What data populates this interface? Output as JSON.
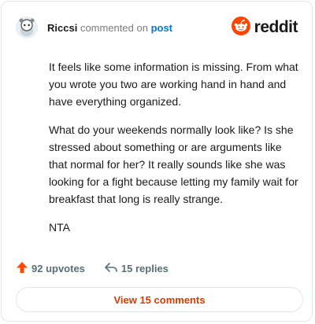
{
  "header": {
    "username": "Riccsi",
    "action_text": "commented on",
    "link_text": "post",
    "brand": "reddit",
    "avatar_icon": "snoo-avatar-icon",
    "brand_icon": "reddit-logo-icon",
    "brand_color": "#ff4500"
  },
  "comment": {
    "paragraphs": [
      "It feels like some information is missing. From what you wrote you two are working hand in hand and have everything organized.",
      "What do your weekends normally look like? Is she stressed about something or are arguments like that normal for her? It really sounds like she was looking for a fight because letting my family wait for breakfast that long is really strange.",
      "NTA"
    ]
  },
  "actions": {
    "upvotes": "92 upvotes",
    "replies": "15 replies",
    "upvote_icon": "upvote-arrow-icon",
    "reply_icon": "reply-arrow-icon"
  },
  "footer": {
    "view_comments": "View 15 comments"
  }
}
